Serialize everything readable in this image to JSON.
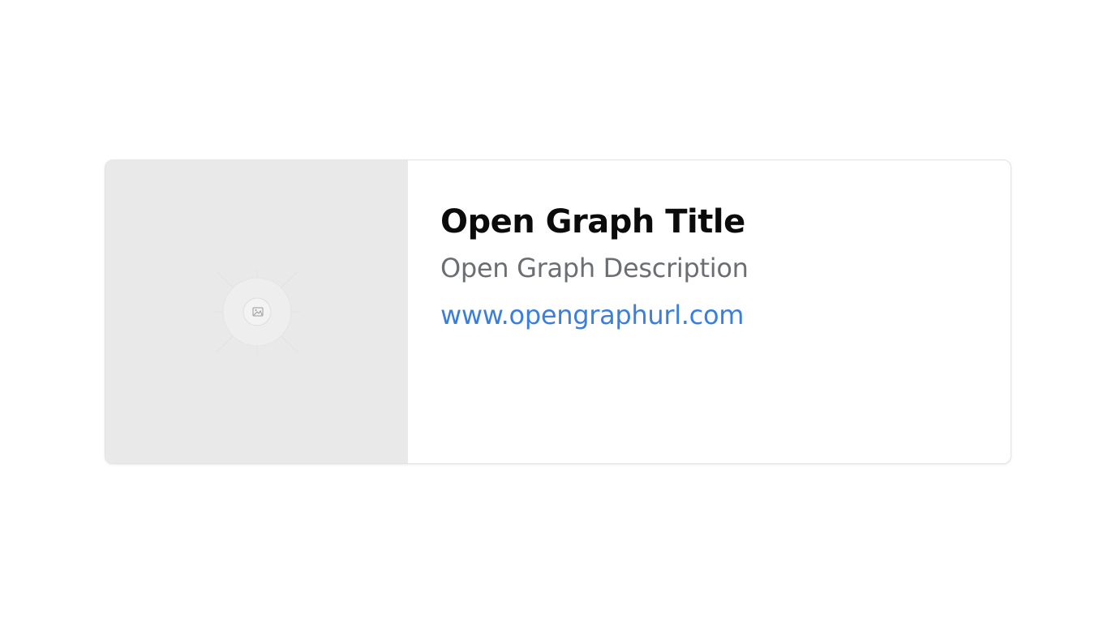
{
  "card": {
    "title": "Open Graph Title",
    "description": "Open Graph Description",
    "url": "www.opengraphurl.com"
  },
  "colors": {
    "title": "#0b0b0b",
    "description": "#6b6f73",
    "url": "#3b7fdc",
    "image_placeholder_bg": "#e9e9e9"
  },
  "icons": {
    "image_placeholder": "image-icon"
  }
}
